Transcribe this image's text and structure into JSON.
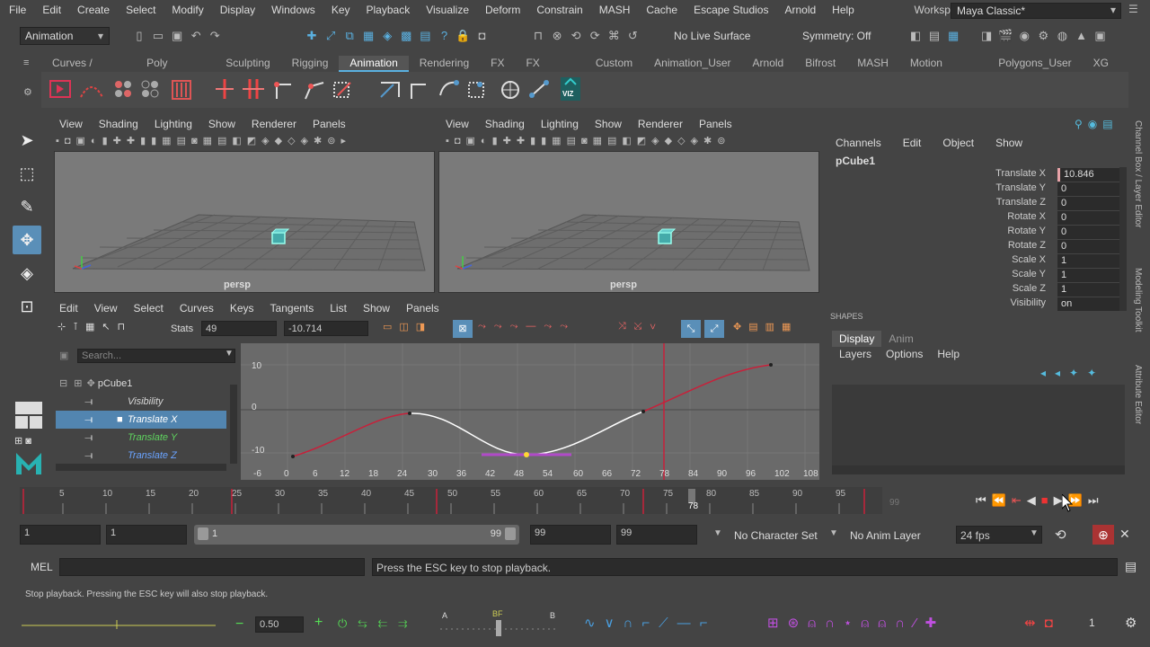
{
  "menubar": {
    "items": [
      "File",
      "Edit",
      "Create",
      "Select",
      "Modify",
      "Display",
      "Windows",
      "Key",
      "Playback",
      "Visualize",
      "Deform",
      "Constrain",
      "MASH",
      "Cache",
      "Escape Studios",
      "Arnold",
      "Help"
    ],
    "workspace_label": "Workspace :",
    "workspace_value": "Maya Classic*"
  },
  "statusline": {
    "mode": "Animation",
    "live_surface": "No Live Surface",
    "symmetry": "Symmetry: Off"
  },
  "shelf": {
    "tabs": [
      "Curves / Surfaces",
      "Poly Modeling",
      "Sculpting",
      "Rigging",
      "Animation",
      "Rendering",
      "FX",
      "FX Caching",
      "Custom",
      "Animation_User",
      "Arnold",
      "Bifrost",
      "MASH",
      "Motion Graphics",
      "Polygons_User",
      "XG"
    ],
    "active_tab": "Animation",
    "viz_label": "VIZ"
  },
  "viewport_menu": [
    "View",
    "Shading",
    "Lighting",
    "Show",
    "Renderer",
    "Panels"
  ],
  "viewports": [
    {
      "label": "persp"
    },
    {
      "label": "persp"
    }
  ],
  "graph_editor": {
    "menu": [
      "Edit",
      "View",
      "Select",
      "Curves",
      "Keys",
      "Tangents",
      "List",
      "Show",
      "Panels"
    ],
    "stats_label": "Stats",
    "frame_value": "49",
    "value_field": "-10.714",
    "search_placeholder": "Search...",
    "outliner": {
      "object": "pCube1",
      "channels": [
        {
          "name": "Visibility",
          "color": "#d8d8d8"
        },
        {
          "name": "Translate X",
          "color": "#ffffff"
        },
        {
          "name": "Translate Y",
          "color": "#5fd35f"
        },
        {
          "name": "Translate Z",
          "color": "#6aa3ff"
        }
      ],
      "selected": "Translate X"
    },
    "y_ticks": [
      "10",
      "0",
      "-10"
    ],
    "x_ticks": [
      "-6",
      "0",
      "6",
      "12",
      "18",
      "24",
      "30",
      "36",
      "42",
      "48",
      "54",
      "60",
      "66",
      "72",
      "78",
      "84",
      "90",
      "96",
      "102",
      "108"
    ]
  },
  "channel_box": {
    "menu": [
      "Channels",
      "Edit",
      "Object",
      "Show"
    ],
    "object": "pCube1",
    "attributes": [
      {
        "label": "Translate X",
        "value": "10.846",
        "keyed": true
      },
      {
        "label": "Translate Y",
        "value": "0",
        "keyed": false
      },
      {
        "label": "Translate Z",
        "value": "0",
        "keyed": false
      },
      {
        "label": "Rotate X",
        "value": "0",
        "keyed": false
      },
      {
        "label": "Rotate Y",
        "value": "0",
        "keyed": false
      },
      {
        "label": "Rotate Z",
        "value": "0",
        "keyed": false
      },
      {
        "label": "Scale X",
        "value": "1",
        "keyed": false
      },
      {
        "label": "Scale Y",
        "value": "1",
        "keyed": false
      },
      {
        "label": "Scale Z",
        "value": "1",
        "keyed": false
      },
      {
        "label": "Visibility",
        "value": "on",
        "keyed": false
      }
    ],
    "shapes_label": "SHAPES"
  },
  "layer_editor": {
    "tabs": [
      "Display",
      "Anim"
    ],
    "active_tab": "Display",
    "menu": [
      "Layers",
      "Options",
      "Help"
    ]
  },
  "side_tabs": [
    "Channel Box / Layer Editor",
    "Modeling Toolkit",
    "Attribute Editor"
  ],
  "time_slider": {
    "ticks": [
      "5",
      "10",
      "15",
      "20",
      "25",
      "30",
      "35",
      "40",
      "45",
      "50",
      "55",
      "60",
      "65",
      "70",
      "75",
      "80",
      "85",
      "90",
      "95"
    ],
    "current_frame": "78",
    "end_label": "99",
    "key_frames": [
      25,
      49,
      73
    ]
  },
  "range_slider": {
    "start": "1",
    "anim_start": "1",
    "range_start": "1",
    "range_end": "99",
    "anim_end": "99",
    "end": "99",
    "character_set": "No Character Set",
    "anim_layer": "No Anim Layer",
    "fps": "24 fps"
  },
  "command_line": {
    "label": "MEL",
    "message": "Press the ESC key to stop playback."
  },
  "help_line": "Stop playback.  Pressing the ESC key will also stop playback.",
  "bottom_shelf": {
    "weight": "0.50",
    "bf_labels": [
      "A",
      "BF",
      "B"
    ],
    "count": "1"
  }
}
